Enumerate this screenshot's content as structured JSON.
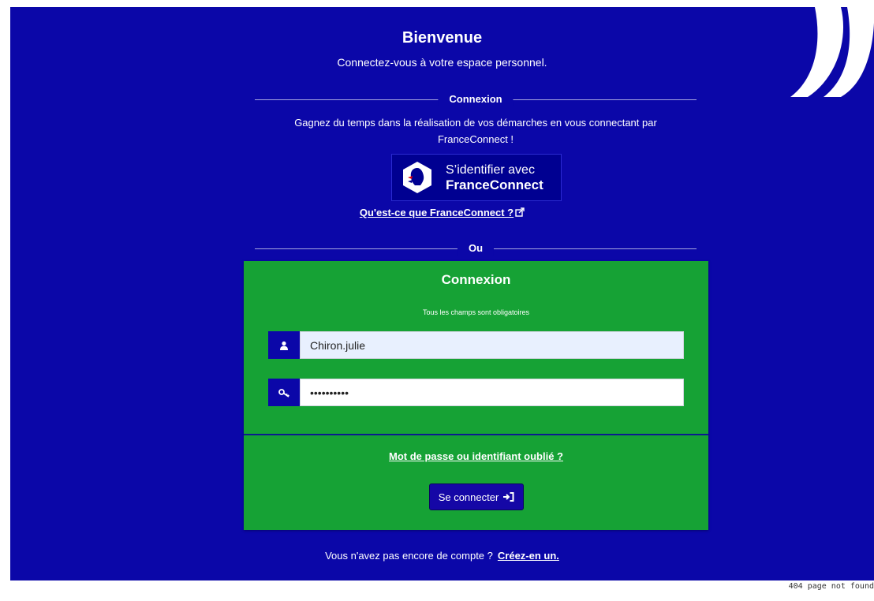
{
  "header": {
    "title": "Bienvenue",
    "subtitle": "Connectez-vous à votre espace personnel."
  },
  "login_section": {
    "divider_label": "Connexion",
    "intro_text": "Gagnez du temps dans la réalisation de vos démarches en vous connectant par FranceConnect !"
  },
  "franceconnect": {
    "button_line1": "S’identifier avec",
    "button_line2": "FranceConnect",
    "info_link": "Qu'est-ce que FranceConnect ?"
  },
  "or_divider": "Ou",
  "login_card": {
    "title": "Connexion",
    "required_note": "Tous les champs sont obligatoires",
    "username_value": "Chiron.julie",
    "password_value": "••••••••••",
    "forgot_link": "Mot de passe ou identifiant oublié ?",
    "submit_label": "Se connecter"
  },
  "signup": {
    "prompt": "Vous n'avez pas encore de compte ?",
    "link": "Créez-en un."
  },
  "error_text": "404 page not found",
  "colors": {
    "background": "#0b07a8",
    "card": "#16a235",
    "button": "#1507a6",
    "fc_button": "#000091"
  },
  "icons": {
    "user_addon": "user-icon",
    "password_addon": "key-icon",
    "submit": "sign-in-icon",
    "external": "external-link-icon"
  }
}
